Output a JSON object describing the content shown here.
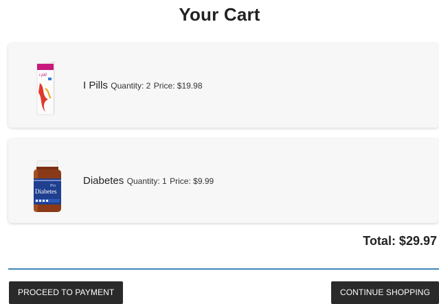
{
  "page": {
    "title": "Your Cart"
  },
  "cart": {
    "items": [
      {
        "name": "I Pills",
        "quantity_text": "Quantity: 2",
        "price_text": "Price: $19.98",
        "image_icon": "ipill-package-image",
        "image_label": "i-pill"
      },
      {
        "name": "Diabetes",
        "quantity_text": "Quantity: 1",
        "price_text": "Price: $9.99",
        "image_icon": "medicine-bottle-image",
        "image_label": "Diabetes"
      }
    ],
    "total_text": "Total: $29.97"
  },
  "actions": {
    "proceed_label": "PROCEED TO PAYMENT",
    "continue_label": "CONTINUE SHOPPING"
  },
  "colors": {
    "divider": "#3d86b8",
    "button_bg": "#2a2a2a",
    "card_bg": "#f7f7f7"
  }
}
